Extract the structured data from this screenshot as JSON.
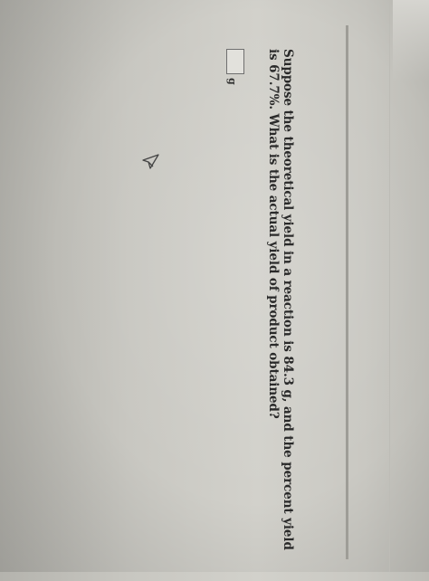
{
  "question": {
    "text": "Suppose the theoretical yield in a reaction is 84.3 g, and the percent yield is 67.7%. What is the actual yield of product obtained?"
  },
  "answer": {
    "value": "",
    "unit": "g"
  },
  "icons": {
    "cursor": "mouse-pointer-icon"
  }
}
